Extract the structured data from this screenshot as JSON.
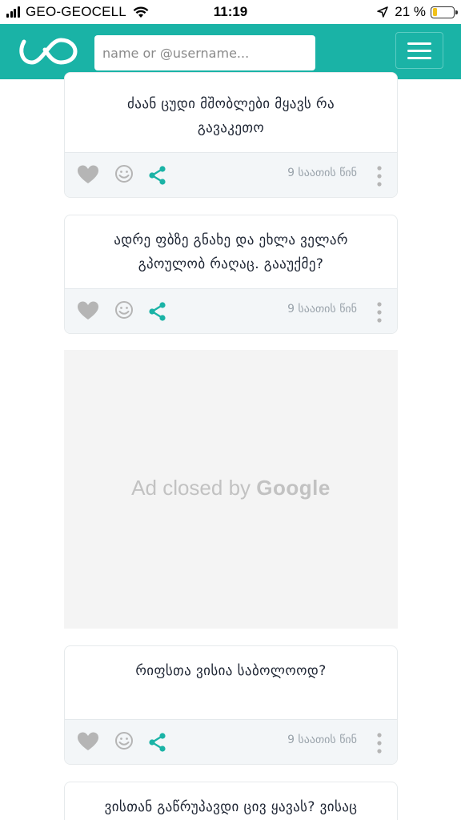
{
  "status_bar": {
    "carrier": "GEO-GEOCELL",
    "time": "11:19",
    "battery_percent": "21 %",
    "battery_level": 0.21
  },
  "header": {
    "search_placeholder": "name or @username..."
  },
  "posts": [
    {
      "text": "ძაან ცუდი მშობლები მყავს რა გავაკეთო",
      "time": "9 საათის წინ"
    },
    {
      "text": "ადრე ფბზე გნახე და ეხლა ველარ გპოულობ რაღაც. გააუქმე?",
      "time": "9 საათის წინ"
    },
    {
      "text": "რიფსთა ვისია საბოლოოდ?",
      "time": "9 საათის წინ"
    },
    {
      "text": "ვისთან გაწრუპავდი ცივ ყავას? ვისაც არ",
      "time": ""
    }
  ],
  "ad": {
    "prefix": "Ad closed by ",
    "brand": "Google"
  },
  "colors": {
    "brand": "#1ab3a6",
    "share": "#1ab3a6",
    "muted_icon": "#b5b5b5"
  }
}
